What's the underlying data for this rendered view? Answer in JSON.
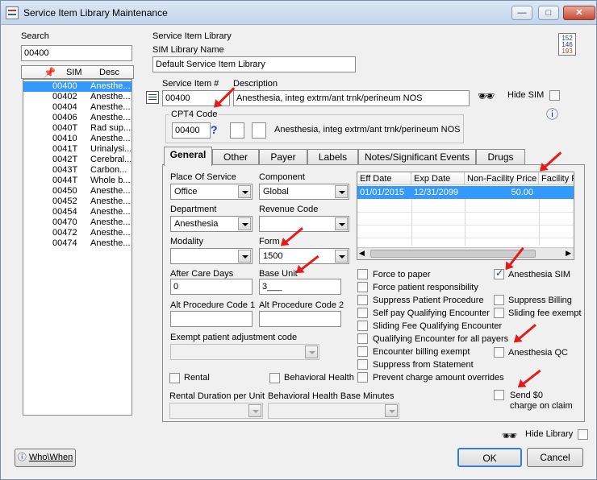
{
  "window": {
    "title": "Service Item Library Maintenance"
  },
  "search": {
    "label": "Search",
    "value": "00400",
    "col_sim": "SIM",
    "col_desc": "Desc",
    "rows": [
      {
        "sim": "00400",
        "desc": "Anesthe..."
      },
      {
        "sim": "00402",
        "desc": "Anesthe..."
      },
      {
        "sim": "00404",
        "desc": "Anesthe..."
      },
      {
        "sim": "00406",
        "desc": "Anesthe..."
      },
      {
        "sim": "0040T",
        "desc": "Rad sup..."
      },
      {
        "sim": "00410",
        "desc": "Anesthe..."
      },
      {
        "sim": "0041T",
        "desc": "Urinalysi..."
      },
      {
        "sim": "0042T",
        "desc": "Cerebral..."
      },
      {
        "sim": "0043T",
        "desc": "Carbon..."
      },
      {
        "sim": "0044T",
        "desc": "Whole b..."
      },
      {
        "sim": "00450",
        "desc": "Anesthe..."
      },
      {
        "sim": "00452",
        "desc": "Anesthe..."
      },
      {
        "sim": "00454",
        "desc": "Anesthe..."
      },
      {
        "sim": "00470",
        "desc": "Anesthe..."
      },
      {
        "sim": "00472",
        "desc": "Anesthe..."
      },
      {
        "sim": "00474",
        "desc": "Anesthe..."
      }
    ]
  },
  "library": {
    "group_label": "Service Item Library",
    "name_label": "SIM Library Name",
    "name_value": "Default Service Item Library"
  },
  "item": {
    "number_label": "Service Item #",
    "number_value": "00400",
    "desc_label": "Description",
    "desc_value": "Anesthesia, integ extrm/ant trnk/perineum NOS",
    "hide_sim_label": "Hide SIM"
  },
  "cpt4": {
    "label": "CPT4 Code",
    "value": "00400",
    "help": "?",
    "desc": "Anesthesia, integ extrm/ant trnk/perineum NOS"
  },
  "tabs": [
    {
      "label": "General"
    },
    {
      "label": "Other"
    },
    {
      "label": "Payer"
    },
    {
      "label": "Labels"
    },
    {
      "label": "Notes/Significant Events"
    },
    {
      "label": "Drugs"
    }
  ],
  "general": {
    "pos_label": "Place Of Service",
    "pos_value": "Office",
    "component_label": "Component",
    "component_value": "Global",
    "dept_label": "Department",
    "dept_value": "Anesthesia",
    "revenue_label": "Revenue Code",
    "revenue_value": "",
    "modality_label": "Modality",
    "modality_value": "",
    "form_label": "Form",
    "form_value": "1500",
    "after_care_label": "After Care Days",
    "after_care_value": "0",
    "base_unit_label": "Base Unit",
    "base_unit_value": "3___",
    "alt1_label": "Alt Procedure Code 1",
    "alt1_value": "",
    "alt2_label": "Alt Procedure Code 2",
    "alt2_value": "",
    "exempt_label": "Exempt patient adjustment code",
    "rental_label": "Rental",
    "behavioral_label": "Behavioral Health",
    "rental_duration_label": "Rental Duration per Unit",
    "behavioral_minutes_label": "Behavioral Health Base Minutes"
  },
  "fee_grid": {
    "columns": [
      "Eff Date",
      "Exp Date",
      "Non-Facility Price",
      "Facility P"
    ],
    "rows": [
      {
        "eff": "01/01/2015",
        "exp": "12/31/2099",
        "price": "50.00",
        "facility": ""
      }
    ]
  },
  "checks_left": [
    {
      "label": "Force to paper",
      "checked": false
    },
    {
      "label": "Force patient responsibility",
      "checked": false
    },
    {
      "label": "Suppress Patient Procedure",
      "checked": false
    },
    {
      "label": "Self pay Qualifying Encounter",
      "checked": false
    },
    {
      "label": "Sliding Fee Qualifying Encounter",
      "checked": false
    },
    {
      "label": "Qualifying Encounter for all payers",
      "checked": false
    },
    {
      "label": "Encounter billing exempt",
      "checked": false
    },
    {
      "label": "Suppress from Statement",
      "checked": false
    },
    {
      "label": "Prevent charge amount overrides",
      "checked": false
    }
  ],
  "checks_right": {
    "anesthesia_sim": {
      "label": "Anesthesia SIM",
      "checked": true
    },
    "suppress_billing": {
      "label": "Suppress Billing",
      "checked": false
    },
    "sliding_fee_exempt": {
      "label": "Sliding fee exempt",
      "checked": false
    },
    "anesthesia_qc": {
      "label": "Anesthesia QC",
      "checked": false
    },
    "send_zero_line1": "Send $0",
    "send_zero_line2": "charge on claim"
  },
  "footer": {
    "who_when": "Who\\When",
    "hide_library": "Hide Library",
    "ok": "OK",
    "cancel": "Cancel"
  },
  "colors": {
    "selection": "#3399ff",
    "annotation_arrow": "#e51a1a",
    "title_gradient": "#c3d5ec"
  }
}
